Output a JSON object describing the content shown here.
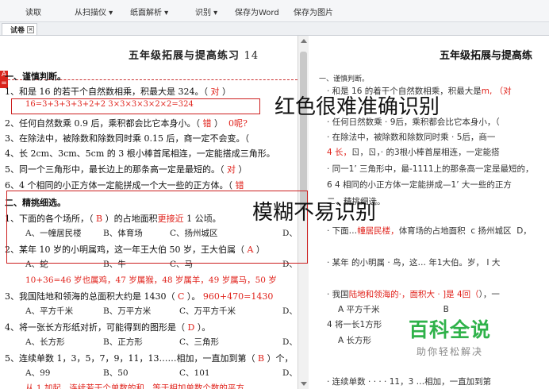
{
  "toolbar": {
    "items": [
      "读取",
      "从扫描仪 ▾",
      "纸面解析 ▾",
      "识别 ▾",
      "保存为Word",
      "保存为图片"
    ]
  },
  "tab": {
    "label": "试卷",
    "close": "×"
  },
  "left": {
    "marker": "A\n=",
    "title": "五年级拓展与提高练习",
    "title_num": "14",
    "section1": "一、谨慎判断。",
    "l1a": "1、和是 16 的若干个自然数相乘，积最大是 324。（",
    "l1ans": " 对 ",
    "l1b": "）",
    "l1red": "16=3+3+3+3+2+2          3×3×3×3×2×2=324",
    "l2a": "2、任何自然数乘 0.9 后，乘积都会比它本身小。（",
    "l2ans": " 错 ",
    "l2b": "）",
    "l2c": "0呢?",
    "l3": "3、在除法中，被除数和除数同时乘 0.15 后，商一定不会变。（",
    "l4": "4、长 2cm、3cm、5cm 的 3 根小棒首尾相连，一定能搭成三角形。",
    "l5a": "5、同一个三角形中，最长边上的那条高一定是最短的。（",
    "l5ans": " 对 ",
    "l5b": "）",
    "l6a": "6、4 个相同的小正方体一定能拼成一个大一些的正方体。（",
    "l6ans": " 错",
    "section2": "二、精挑细选。",
    "q1a": "1、下面的各个场所，（",
    "q1ans": " B ",
    "q1b": "）的占地面积",
    "q1c": "更接近",
    "q1d": " 1 公顷。",
    "q1opts": [
      "A、一幢居民楼",
      "B、体育场",
      "C、扬州城区",
      "D、"
    ],
    "q2a": "2、某年 10 岁的小明属鸡，这一年王大伯 50 岁，王大伯属（",
    "q2ans": " A ",
    "q2b": "）",
    "q2opts": [
      "A、蛇",
      "B、牛",
      "C、马",
      "D、"
    ],
    "q2red": "10+36=46 岁也属鸡，47 岁属猴，48 岁属羊，49 岁属马，50 岁",
    "q3a": "3、我国陆地和领海的总面积大约是 1430（",
    "q3ans": " C ",
    "q3b": "）。",
    "q3c": "960+470=1430",
    "q3opts": [
      "A、平方千米",
      "B、万平方米",
      "C、万平方千米",
      "D、"
    ],
    "q4a": "4、将一张长方形纸对折，可能得到的图形是（",
    "q4ans": " D ",
    "q4b": "）。",
    "q4opts": [
      "A、长方形",
      "B、正方形",
      "C、三角形",
      "D、"
    ],
    "q5a": "5、连续单数 1，3，5，7，9，11，13……相加，一直加到第（",
    "q5ans": " B ",
    "q5b": "）个，",
    "q5opts": [
      "A、99",
      "B、50",
      "C、101",
      "D、"
    ],
    "q5red": "从 1 加起，连续若干个单数的和，等于相加单数个数的平方"
  },
  "right": {
    "title": "五年级拓展与提高练",
    "r1": "一、谨慎判断。",
    "r2": "· 和是  16  的着干个自然数相乘，积最大是",
    "r2red": "m,",
    "r2end": "（对",
    "r3": "· 任何日然数乘 · 9后，乘积都会比它本身小，（",
    "r4a": "· 在除法中，被除数和除数同时乘 · 5后，商一",
    "r5a": "4 长，",
    "r5b": "ㄖ，ㄖ，· 的3根小棒首屋相连，一定能搭",
    "r6": "· 同一1’ 三角形中，最-1111上的那条高一定是最短的，",
    "r7": "6 4 相同的小正方体一定能拼成—1’ 大一些的正方",
    "r8": "二、精挑细选。",
    "r9a": "· 下面…",
    "r9b": "幢居民楼，",
    "r9c": "体育场的占地面积",
    "r9d": "c  扬州城区",
    "r9e": "D，",
    "r10a": "· 某年",
    "r10b": "的小明属 · 鸟，这… 年1大伯。岁，",
    "r10c": "I 大",
    "r11": "· 我国",
    "r11b": "陆地和领海的·，面积大 · ]是 4回（",
    "r11c": "），一",
    "r12": "A  平方千米",
    "r12b": "B",
    "r13": "4  将一长1方形",
    "r14": "A  长方形",
    "r15": "· 连续单数 · · · · 11，3 …相加，一直加到第"
  },
  "annotations": {
    "box1_label": "红色很难准确识别",
    "box2_label": "模糊不易识别"
  },
  "watermark": {
    "big": "百科全说",
    "small": "助你轻松解决"
  }
}
